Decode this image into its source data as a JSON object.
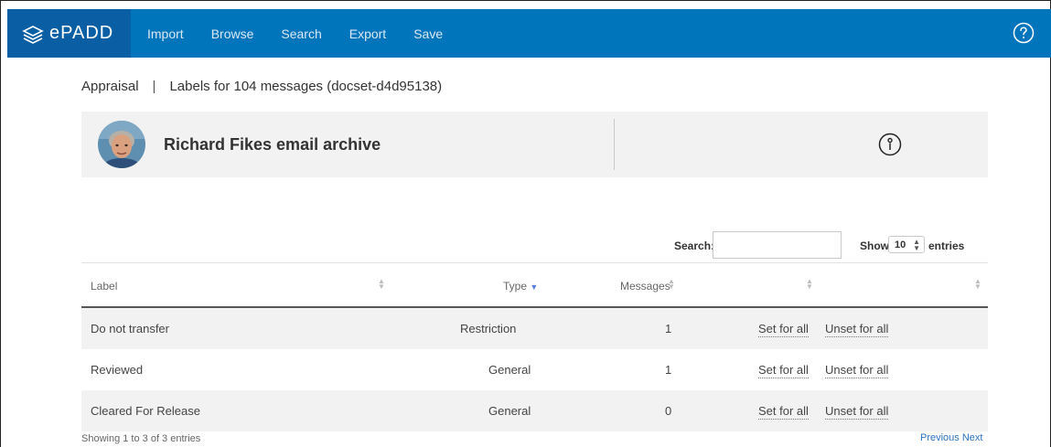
{
  "nav": {
    "brand": "ePADD",
    "items": [
      "Import",
      "Browse",
      "Search",
      "Export",
      "Save"
    ]
  },
  "breadcrumb": {
    "section": "Appraisal",
    "separator": "|",
    "page": "Labels for 104 messages (docset-d4d95138)"
  },
  "archive": {
    "title": "Richard Fikes email archive"
  },
  "controls": {
    "search_label": "Search:",
    "search_value": "",
    "show_label": "Show",
    "show_value": "10",
    "entries_label": "entries"
  },
  "table": {
    "headers": [
      "Label",
      "Type",
      "Messages",
      "",
      ""
    ],
    "rows": [
      {
        "label": "Do not transfer",
        "type": "Restriction",
        "messages": "1",
        "set": "Set for all",
        "unset": "Unset for all"
      },
      {
        "label": "Reviewed",
        "type": "General",
        "messages": "1",
        "set": "Set for all",
        "unset": "Unset for all"
      },
      {
        "label": "Cleared For Release",
        "type": "General",
        "messages": "0",
        "set": "Set for all",
        "unset": "Unset for all"
      }
    ]
  },
  "footer": {
    "info": "Showing 1 to 3 of 3 entries",
    "previous": "Previous",
    "next": "Next"
  },
  "colors": {
    "nav_bg": "#0075bb",
    "brand_bg": "#0a5fa4",
    "card_bg": "#f2f2f2",
    "link": "#2b72c2"
  },
  "icons": {
    "brand": "layers-logo-icon",
    "help": "question-circle-icon",
    "info": "info-circle-icon"
  }
}
